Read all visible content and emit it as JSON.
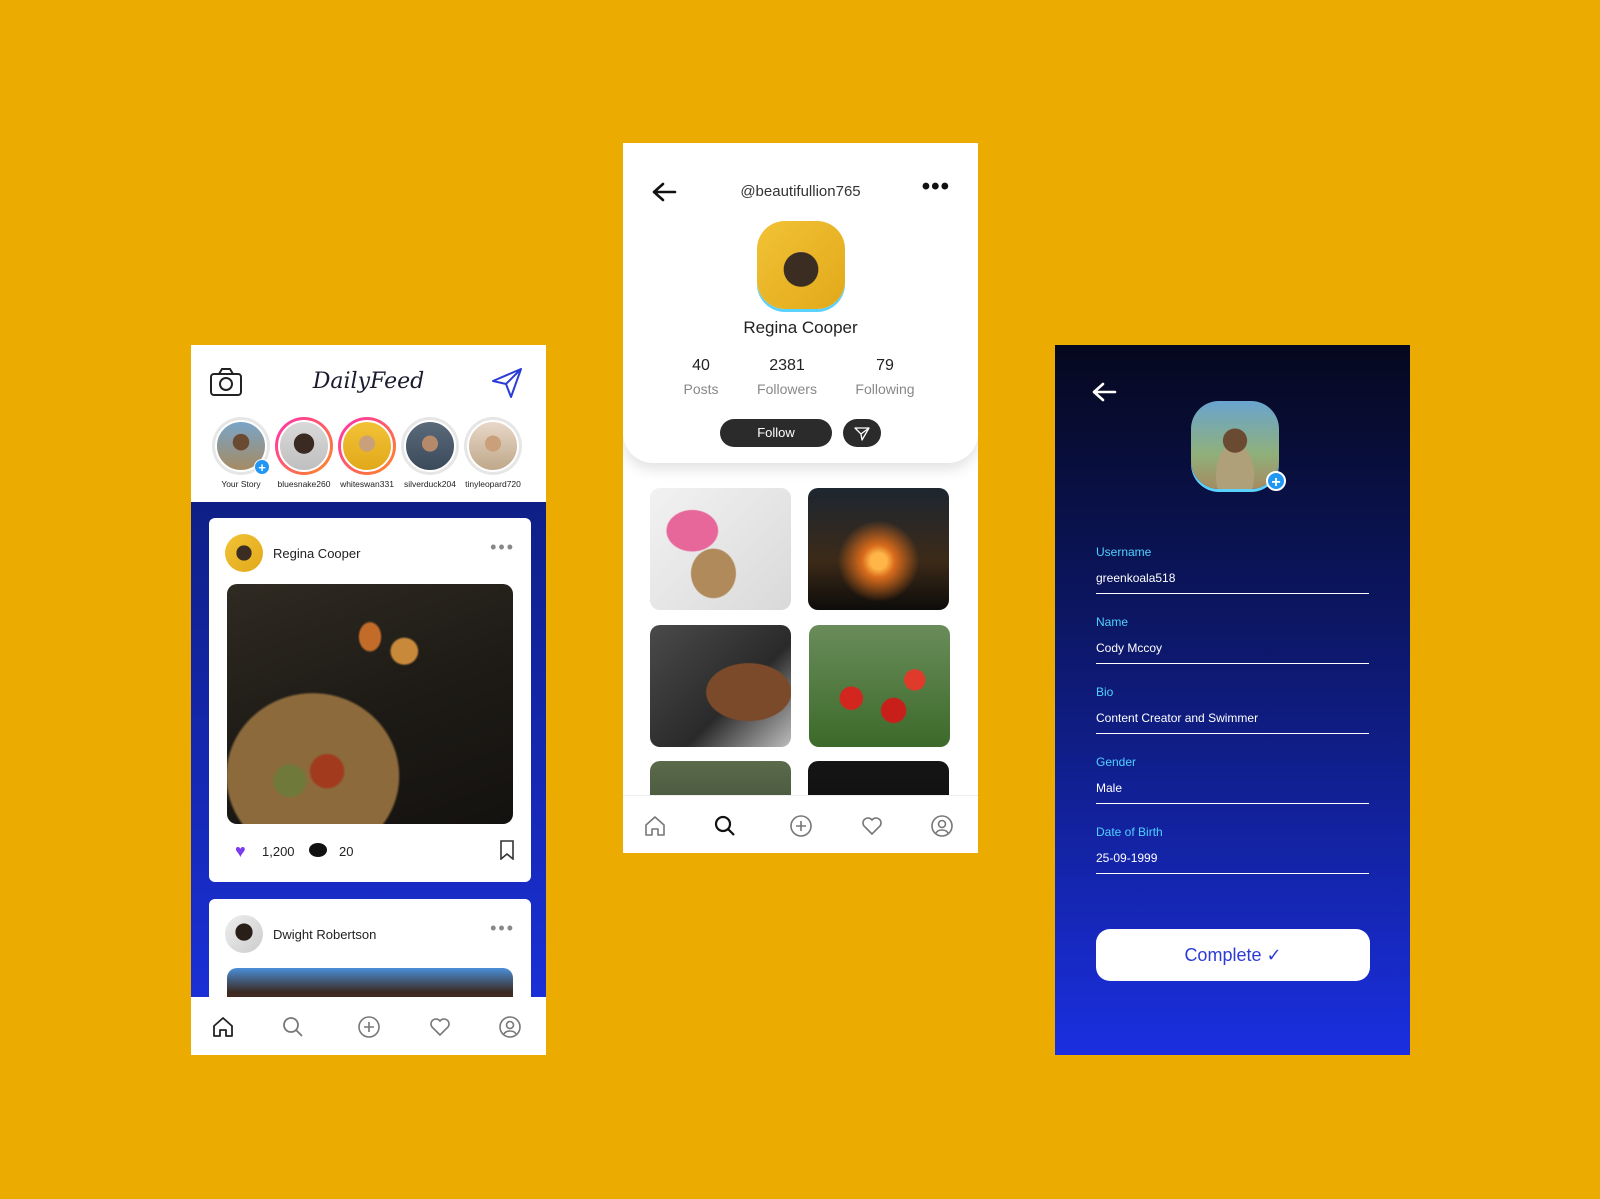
{
  "colors": {
    "background": "#EBAB00",
    "feed_gradient_top": "#0f1f86",
    "feed_gradient_bottom": "#1a2fd6",
    "accent_blue": "#2196F3",
    "label_cyan": "#4fd0ff",
    "like_purple": "#7a3cf0"
  },
  "feed": {
    "logo": "DailyFeed",
    "stories": [
      {
        "label": "Your Story"
      },
      {
        "label": "bluesnake260"
      },
      {
        "label": "whiteswan331"
      },
      {
        "label": "silverduck204"
      },
      {
        "label": "tinyleopard720"
      }
    ],
    "posts": [
      {
        "author": "Regina Cooper",
        "likes": "1,200",
        "comments": "20"
      },
      {
        "author": "Dwight Robertson"
      }
    ]
  },
  "profile": {
    "handle": "@beautifullion765",
    "name": "Regina Cooper",
    "stats": [
      {
        "value": "40",
        "label": "Posts"
      },
      {
        "value": "2381",
        "label": "Followers"
      },
      {
        "value": "79",
        "label": "Following"
      }
    ],
    "follow_label": "Follow"
  },
  "edit": {
    "fields": [
      {
        "label": "Username",
        "value": "greenkoala518"
      },
      {
        "label": "Name",
        "value": "Cody Mccoy"
      },
      {
        "label": "Bio",
        "value": "Content Creator and Swimmer"
      },
      {
        "label": "Gender",
        "value": "Male"
      },
      {
        "label": "Date of Birth",
        "value": "25-09-1999"
      }
    ],
    "complete_label": "Complete ✓"
  }
}
